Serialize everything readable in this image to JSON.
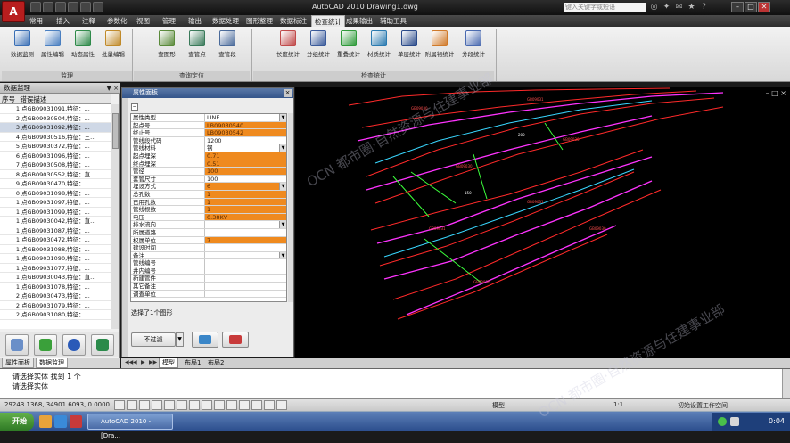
{
  "titlebar": {
    "app_logo": "A",
    "title": "AutoCAD 2010   Drawing1.dwg",
    "search_placeholder": "键入关键字或短语",
    "minimize": "–",
    "maximize": "□",
    "close": "✕"
  },
  "menu_tabs": [
    "常用",
    "插入",
    "注释",
    "参数化",
    "视图",
    "管理",
    "输出",
    "数据处理",
    "图形整理",
    "数据标注",
    "检查统计",
    "成果输出",
    "辅助工具"
  ],
  "active_menu_tab": "检查统计",
  "ribbon": {
    "buttons": [
      {
        "label": "数据监测",
        "color": "#3a6fb5"
      },
      {
        "label": "属性编辑",
        "color": "#4a7fc0"
      },
      {
        "label": "动态属性",
        "color": "#2f8a4a"
      },
      {
        "label": "批量编辑",
        "color": "#c08a2a"
      },
      {
        "label": "查图形",
        "color": "#5a8a3a"
      },
      {
        "label": "查管点",
        "color": "#3a7a5a"
      },
      {
        "label": "查管段",
        "color": "#4a6a9a"
      },
      {
        "label": "长度统计",
        "color": "#c04a4a"
      },
      {
        "label": "分组统计",
        "color": "#3a5a9a"
      },
      {
        "label": "重叠统计",
        "color": "#2f9a3a"
      },
      {
        "label": "材质统计",
        "color": "#2a7ab0"
      },
      {
        "label": "单层统计",
        "color": "#2a4a8a"
      },
      {
        "label": "附属物统计",
        "color": "#d07a2a"
      },
      {
        "label": "分段统计",
        "color": "#4a6ab0"
      }
    ],
    "groups": [
      {
        "label": "监理"
      },
      {
        "label": "查询定位"
      },
      {
        "label": "检查统计"
      }
    ]
  },
  "left_panel": {
    "title": "数据监理",
    "header_buttons": "▼ ×",
    "col_index": "序号",
    "col_desc": "错误描述",
    "rows": [
      {
        "n": "1",
        "text": "点GB09031091,特征：..."
      },
      {
        "n": "2",
        "text": "点GB09030504,特征：..."
      },
      {
        "n": "3",
        "text": "点GB09031092,特征：..."
      },
      {
        "n": "4",
        "text": "点GB09030516,特征：三..."
      },
      {
        "n": "5",
        "text": "点GB09030372,特征：..."
      },
      {
        "n": "6",
        "text": "点GB09031096,特征：..."
      },
      {
        "n": "7",
        "text": "点GB09030508,特征：..."
      },
      {
        "n": "8",
        "text": "点GB09030552,特征：直..."
      },
      {
        "n": "9",
        "text": "点GB09030470,特征：..."
      },
      {
        "n": "0",
        "text": "点GB09031098,特征：..."
      },
      {
        "n": "1",
        "text": "点GB09031097,特征：..."
      },
      {
        "n": "1",
        "text": "点GB09031099,特征：..."
      },
      {
        "n": "1",
        "text": "点GB09030042,特征：直..."
      },
      {
        "n": "1",
        "text": "点GB09031087,特征：..."
      },
      {
        "n": "1",
        "text": "点GB09030472,特征：..."
      },
      {
        "n": "1",
        "text": "点GB09031088,特征：..."
      },
      {
        "n": "1",
        "text": "点GB09031090,特征：..."
      },
      {
        "n": "1",
        "text": "点GB09031077,特征：..."
      },
      {
        "n": "1",
        "text": "点GB09030043,特征：直..."
      },
      {
        "n": "1",
        "text": "点GB09031078,特征：..."
      },
      {
        "n": "2",
        "text": "点GB09030473,特征：..."
      },
      {
        "n": "2",
        "text": "点GB09031079,特征：..."
      },
      {
        "n": "2",
        "text": "点GB09031080,特征：..."
      }
    ],
    "tabs": [
      "属性面板",
      "数据监理"
    ],
    "active_tab": "数据监理"
  },
  "properties": {
    "title": "属性面板",
    "close": "×",
    "rows": [
      {
        "key": "属性类型",
        "value": "LINE",
        "style": "white",
        "dd": true
      },
      {
        "key": "起点号",
        "value": "LB09030540",
        "style": "orange",
        "dd": false
      },
      {
        "key": "终止号",
        "value": "LB09030542",
        "style": "orange",
        "dd": false
      },
      {
        "key": "管线段代码",
        "value": "1200",
        "style": "white",
        "dd": false
      },
      {
        "key": "管线材料",
        "value": "钢",
        "style": "white",
        "dd": true
      },
      {
        "key": "起点埋深",
        "value": "0.71",
        "style": "orange",
        "dd": false
      },
      {
        "key": "终点埋深",
        "value": "0.51",
        "style": "orange",
        "dd": false
      },
      {
        "key": "管径",
        "value": "100",
        "style": "orange",
        "dd": false
      },
      {
        "key": "套管尺寸",
        "value": "100",
        "style": "white",
        "dd": false
      },
      {
        "key": "埋设方式",
        "value": "6",
        "style": "orange",
        "dd": true
      },
      {
        "key": "总孔数",
        "value": "1",
        "style": "orange",
        "dd": false
      },
      {
        "key": "已用孔数",
        "value": "1",
        "style": "orange",
        "dd": false
      },
      {
        "key": "管线根数",
        "value": "1",
        "style": "orange",
        "dd": false
      },
      {
        "key": "电压",
        "value": "0.38KV",
        "style": "orange",
        "dd": false
      },
      {
        "key": "排水流向",
        "value": "",
        "style": "white",
        "dd": true
      },
      {
        "key": "所属道路",
        "value": "",
        "style": "white",
        "dd": false
      },
      {
        "key": "权属单位",
        "value": "7",
        "style": "orange",
        "dd": false
      },
      {
        "key": "建设时间",
        "value": "",
        "style": "white",
        "dd": false
      },
      {
        "key": "备注",
        "value": "",
        "style": "white",
        "dd": true
      },
      {
        "key": "管线编号",
        "value": "",
        "style": "white",
        "dd": false
      },
      {
        "key": "井内编号",
        "value": "",
        "style": "white",
        "dd": false
      },
      {
        "key": "新建管件",
        "value": "",
        "style": "white",
        "dd": false
      },
      {
        "key": "其它备注",
        "value": "",
        "style": "white",
        "dd": false
      },
      {
        "key": "调查单位",
        "value": "",
        "style": "white",
        "dd": false
      }
    ],
    "status": "选择了1个图形",
    "filter_label": "不过滤"
  },
  "canvas": {
    "controls": "–  □  ×",
    "layout_tabs": [
      "模型",
      "布局1",
      "布局2"
    ],
    "active_layout_tab": "模型"
  },
  "command_line": {
    "line1": "请选择实体 找到 1 个",
    "line2": "请选择实体"
  },
  "statusbar": {
    "coords": "29243.1368, 34901.6093, 0.0000",
    "model_label": "模型",
    "scale": "1:1",
    "workspace": "初始设置工作空间"
  },
  "taskbar": {
    "start": "开始",
    "task_label": "AutoCAD 2010 - [Dra...",
    "clock": "0:04"
  },
  "watermark": {
    "text1": "OCN 都市圈·自然资源与住建事业部",
    "text2": "OCN 都市圈·自然资源与住建事业部"
  },
  "colors": {
    "accent_orange": "#ef8a1f",
    "canvas_bg": "#000000",
    "pipe_red": "#ff2a2a",
    "pipe_magenta": "#ff33ff",
    "pipe_cyan": "#39d7ff",
    "pipe_green": "#3cff3c"
  }
}
